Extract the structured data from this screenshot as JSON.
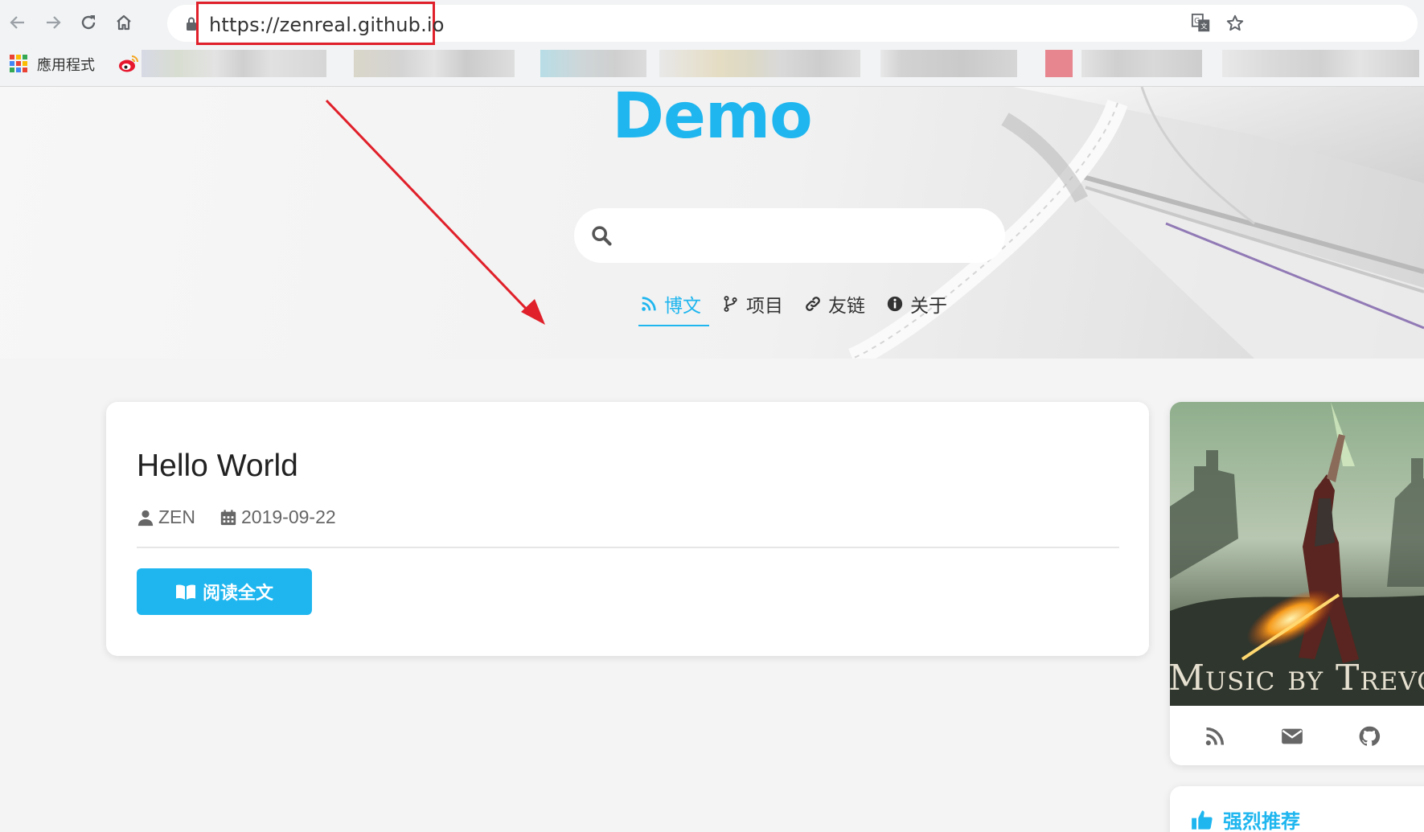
{
  "browser": {
    "url": "https://zenreal.github.io",
    "apps_label": "應用程式",
    "icons": [
      "back-arrow-icon",
      "forward-arrow-icon",
      "reload-icon",
      "home-icon",
      "lock-icon",
      "translate-icon",
      "star-icon",
      "apps-icon",
      "weibo-icon"
    ],
    "highlight_color": "#e0202a"
  },
  "site": {
    "title": "Demo",
    "accent_color": "#1fb6ef",
    "search": {
      "placeholder": ""
    },
    "menu": [
      {
        "label": "博文",
        "icon": "rss-icon",
        "active": true
      },
      {
        "label": "项目",
        "icon": "code-branch-icon",
        "active": false
      },
      {
        "label": "友链",
        "icon": "link-icon",
        "active": false
      },
      {
        "label": "关于",
        "icon": "info-circle-icon",
        "active": false
      }
    ]
  },
  "post": {
    "title": "Hello World",
    "author": "ZEN",
    "date": "2019-09-22",
    "read_button": "阅读全文"
  },
  "sidebar": {
    "cover_caption": "Music by Trevor M",
    "social_icons": [
      "rss-icon",
      "envelope-icon",
      "github-icon"
    ],
    "recommend_title": "强烈推荐"
  }
}
